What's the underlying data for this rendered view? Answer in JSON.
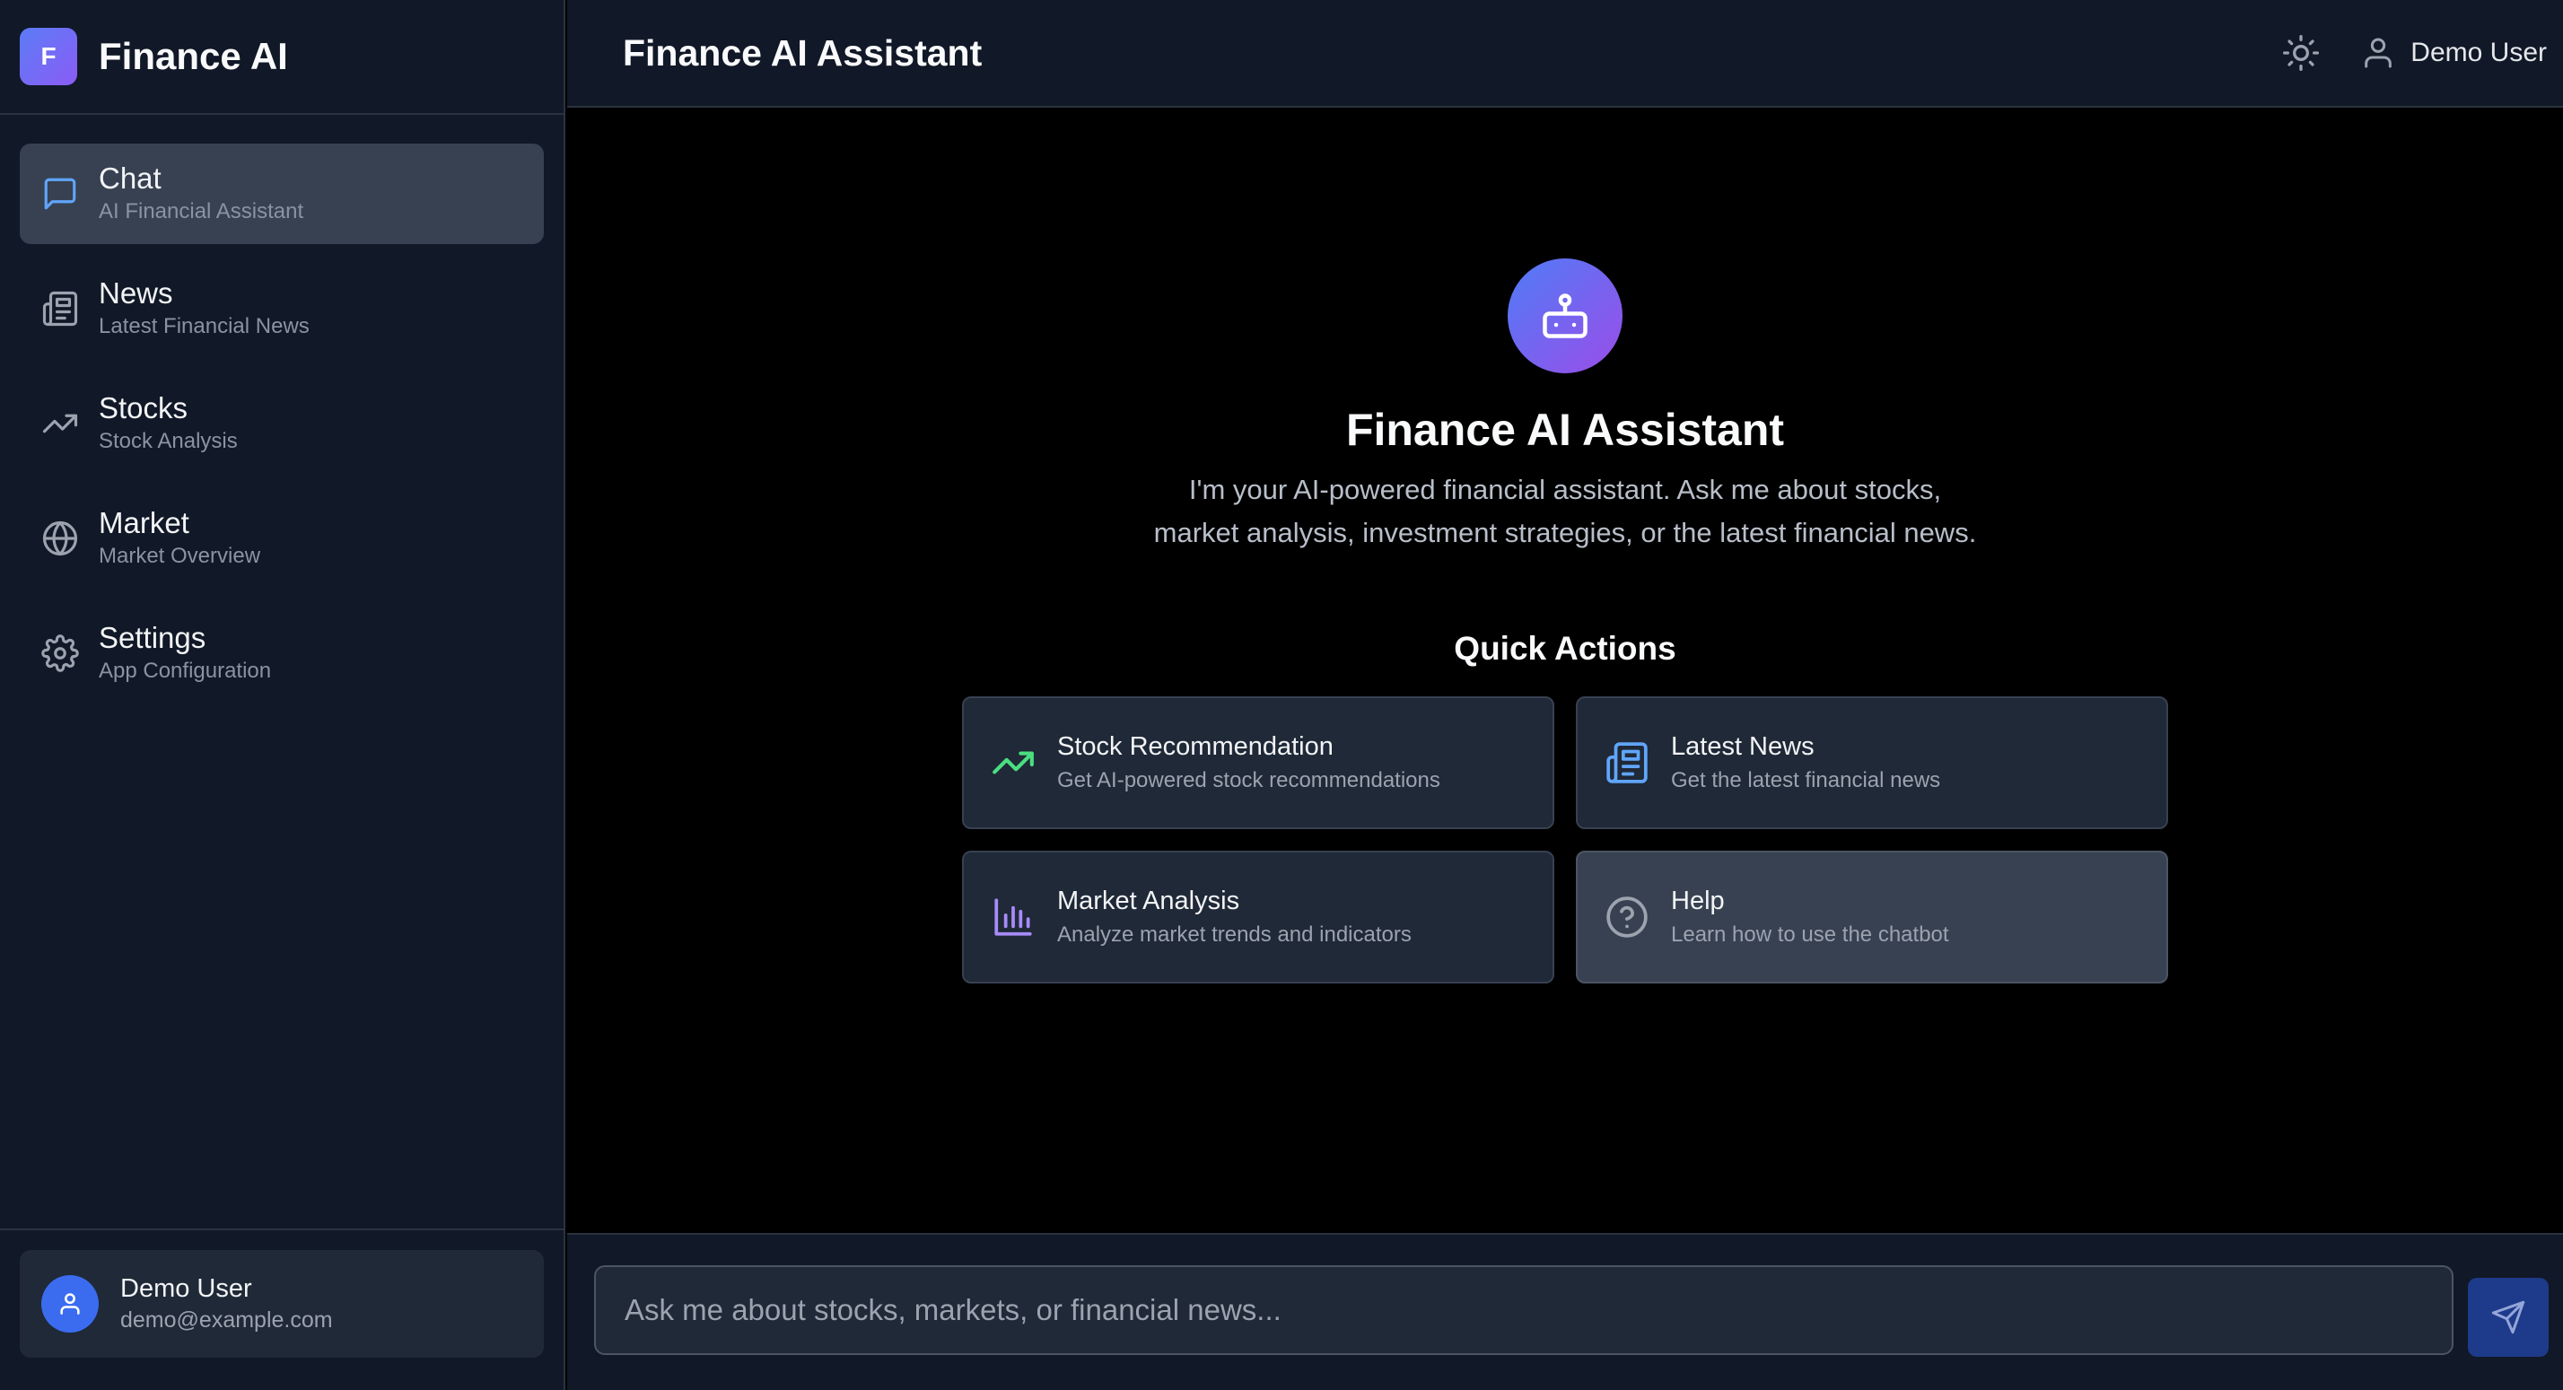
{
  "app": {
    "brand_initial": "F",
    "brand_name": "Finance AI"
  },
  "sidebar": {
    "items": [
      {
        "label": "Chat",
        "sub": "AI Financial Assistant",
        "icon": "chat-bubble-icon",
        "active": true
      },
      {
        "label": "News",
        "sub": "Latest Financial News",
        "icon": "newspaper-icon",
        "active": false
      },
      {
        "label": "Stocks",
        "sub": "Stock Analysis",
        "icon": "trending-up-icon",
        "active": false
      },
      {
        "label": "Market",
        "sub": "Market Overview",
        "icon": "globe-icon",
        "active": false
      },
      {
        "label": "Settings",
        "sub": "App Configuration",
        "icon": "gear-icon",
        "active": false
      }
    ],
    "user": {
      "name": "Demo User",
      "email": "demo@example.com"
    }
  },
  "header": {
    "title": "Finance AI Assistant",
    "user_name": "Demo User"
  },
  "welcome": {
    "title": "Finance AI Assistant",
    "description": "I'm your AI-powered financial assistant. Ask me about stocks, market analysis, investment strategies, or the latest financial news."
  },
  "quick_actions": {
    "title": "Quick Actions",
    "items": [
      {
        "label": "Stock Recommendation",
        "sub": "Get AI-powered stock recommendations",
        "icon": "trending-up-icon",
        "color": "#4ade80"
      },
      {
        "label": "Latest News",
        "sub": "Get the latest financial news",
        "icon": "newspaper-icon",
        "color": "#60a5fa"
      },
      {
        "label": "Market Analysis",
        "sub": "Analyze market trends and indicators",
        "icon": "bar-chart-icon",
        "color": "#a78bfa"
      },
      {
        "label": "Help",
        "sub": "Learn how to use the chatbot",
        "icon": "help-circle-icon",
        "color": "#9ca3af"
      }
    ]
  },
  "chat_input": {
    "placeholder": "Ask me about stocks, markets, or financial news..."
  },
  "colors": {
    "accent": "#3b6cf0",
    "sidebar_bg": "#111827",
    "main_bg": "#000000",
    "card_bg": "#1f2937"
  }
}
